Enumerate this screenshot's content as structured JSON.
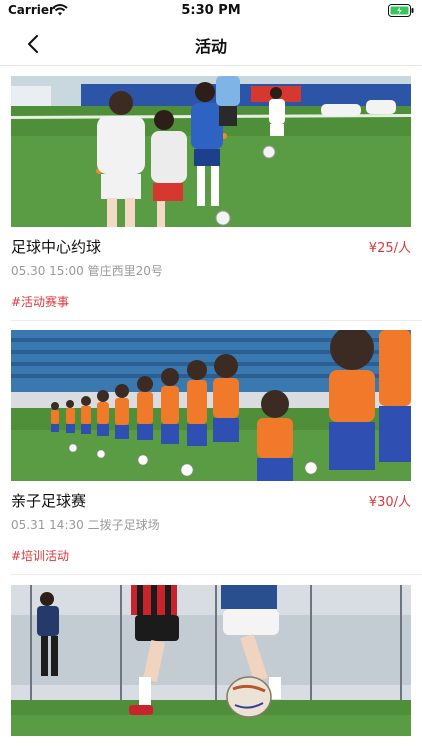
{
  "status_bar": {
    "carrier": "Carrier",
    "time": "5:30 PM"
  },
  "nav": {
    "title": "活动"
  },
  "events": [
    {
      "title": "足球中心约球",
      "price": "¥25/人",
      "date_time": "05.30 15:00",
      "location": "管庄西里20号",
      "tag": "#活动赛事",
      "image": "kids-soccer-drill-photo"
    },
    {
      "title": "亲子足球赛",
      "price": "¥30/人",
      "date_time": "05.31 14:30",
      "location": "二拨子足球场",
      "tag": "#培训活动",
      "image": "kids-soccer-team-photo"
    },
    {
      "title": "",
      "price": "",
      "date_time": "",
      "location": "",
      "tag": "",
      "image": "soccer-match-photo"
    }
  ],
  "colors": {
    "accent": "#e0383b",
    "meta": "#9a9a9a",
    "grass": "#4f8f3a"
  }
}
